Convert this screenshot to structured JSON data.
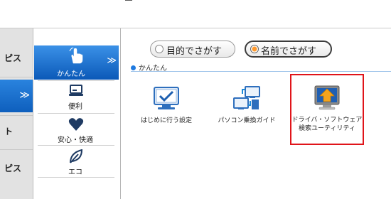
{
  "left_pane": {
    "items": [
      {
        "label": "ピス"
      },
      {
        "label": ""
      },
      {
        "label": "ト"
      },
      {
        "label": "ピス"
      }
    ],
    "active_chevron": "≫"
  },
  "categories": [
    {
      "label": "かんたん",
      "icon": "hand-pointer-icon",
      "active": true
    },
    {
      "label": "便利",
      "icon": "laptop-icon",
      "active": false
    },
    {
      "label": "安心・快適",
      "icon": "heart-icon",
      "active": false
    },
    {
      "label": "エコ",
      "icon": "leaf-icon",
      "active": false
    }
  ],
  "category_chevron": "≫",
  "search_mode": {
    "purpose_label": "目的でさがす",
    "name_label": "名前でさがす",
    "selected": "name"
  },
  "section": {
    "title": "かんたん"
  },
  "tiles": [
    {
      "label": "はじめに行う設定",
      "icon": "checkmark-display-icon",
      "selected": false
    },
    {
      "label": "パソコン乗換ガイド",
      "icon": "pc-transfer-icon",
      "selected": false
    },
    {
      "label_line1": "ドライバ・ソフトウェア",
      "label_line2": "検索ユーティリティ",
      "icon": "up-arrow-monitor-icon",
      "selected": true
    }
  ],
  "colors": {
    "active_blue": "#0e5fbd",
    "highlight_red": "#e0141a",
    "radio_orange": "#ff9a2e"
  }
}
